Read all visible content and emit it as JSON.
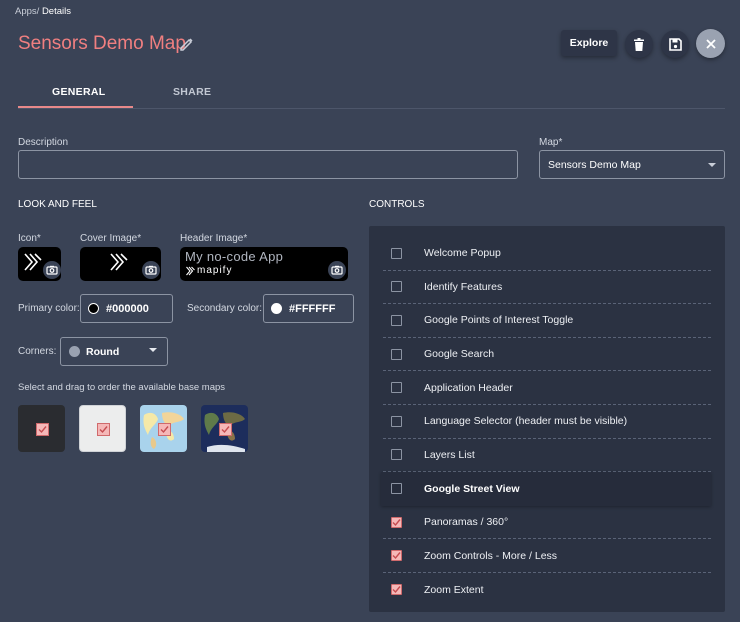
{
  "breadcrumb": {
    "root": "Apps",
    "sep": "/",
    "current": "Details"
  },
  "page_title": "Sensors Demo Map",
  "toolbar": {
    "explore_label": "Explore"
  },
  "tabs": [
    {
      "label": "GENERAL",
      "active": true
    },
    {
      "label": "SHARE",
      "active": false
    }
  ],
  "description": {
    "label": "Description",
    "value": ""
  },
  "map": {
    "label": "Map*",
    "value": "Sensors Demo Map"
  },
  "look_and_feel": {
    "title": "LOOK AND FEEL",
    "icon_label": "Icon*",
    "cover_label": "Cover Image*",
    "header_label": "Header Image*",
    "header_text": "My no-code App",
    "brand_text": "mapify",
    "primary_color_label": "Primary color:",
    "primary_color_value": "#000000",
    "secondary_color_label": "Secondary color:",
    "secondary_color_value": "#FFFFFF",
    "corners_label": "Corners:",
    "corners_value": "Round",
    "basemap_hint": "Select and drag to order the available base maps",
    "basemaps": [
      {
        "name": "dark",
        "checked": true
      },
      {
        "name": "light",
        "checked": true
      },
      {
        "name": "streets",
        "checked": true
      },
      {
        "name": "satellite",
        "checked": true
      }
    ]
  },
  "controls": {
    "title": "CONTROLS",
    "items": [
      {
        "label": "Welcome Popup",
        "checked": false
      },
      {
        "label": "Identify Features",
        "checked": false
      },
      {
        "label": "Google Points of Interest Toggle",
        "checked": false
      },
      {
        "label": "Google Search",
        "checked": false
      },
      {
        "label": "Application Header",
        "checked": false
      },
      {
        "label": "Language Selector (header must be visible)",
        "checked": false
      },
      {
        "label": "Layers List",
        "checked": false
      },
      {
        "label": "Google Street View",
        "checked": false
      },
      {
        "label": "Panoramas / 360°",
        "checked": true
      },
      {
        "label": "Zoom Controls - More / Less",
        "checked": true
      },
      {
        "label": "Zoom Extent",
        "checked": true
      }
    ]
  },
  "colors": {
    "accent": "#f07f80",
    "background": "#3a4356",
    "panel": "#2b3242"
  }
}
